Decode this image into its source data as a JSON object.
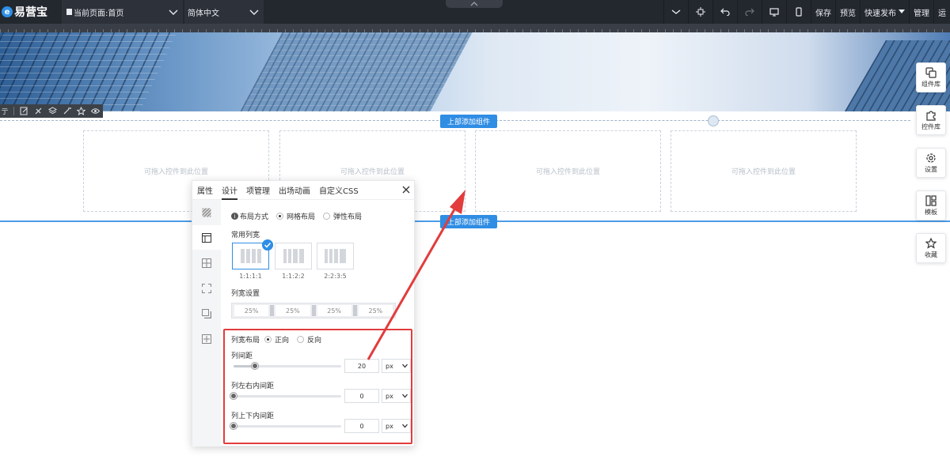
{
  "topbar": {
    "logo_mark": "e",
    "logo_text": "易营宝",
    "current_page": "当前页面:首页",
    "language": "简体中文",
    "save_label": "保存",
    "preview_label": "预览",
    "publish_label": "快速发布",
    "manage_label": "管理",
    "more_label": "运"
  },
  "canvas": {
    "add_top_label": "上部添加组件",
    "add_bottom_label": "上部添加组件",
    "drop_hint": "可拖入控件到此位置"
  },
  "side_menu": [
    {
      "label": "组件库",
      "icon": "layers-icon"
    },
    {
      "label": "控件库",
      "icon": "puzzle-icon"
    },
    {
      "label": "设置",
      "icon": "gear-icon"
    },
    {
      "label": "模板",
      "icon": "template-icon"
    },
    {
      "label": "收藏",
      "icon": "star-icon"
    }
  ],
  "row_toolbar": {
    "lead_label": "亍"
  },
  "panel": {
    "tabs": [
      "属性",
      "设计",
      "项管理",
      "出场动画",
      "自定义CSS"
    ],
    "active_tab": "设计",
    "layout_mode_label": "布局方式",
    "layout_options": [
      "网格布局",
      "弹性布局"
    ],
    "selected_layout": "网格布局",
    "common_widths_label": "常用列宽",
    "presets": [
      "1:1:1:1",
      "1:1:2:2",
      "2:2:3:5"
    ],
    "selected_preset": "1:1:1:1",
    "col_width_label": "列宽设置",
    "col_widths": [
      "25%",
      "25%",
      "25%",
      "25%"
    ],
    "col_layout_label": "列宽布局",
    "direction_options": [
      "正向",
      "反向"
    ],
    "selected_direction": "正向",
    "gap": {
      "label": "列间距",
      "value": "20",
      "unit": "px",
      "level": 0.2
    },
    "pad_lr": {
      "label": "列左右内间距",
      "value": "0",
      "unit": "px",
      "level": 0
    },
    "pad_tb": {
      "label": "列上下内间距",
      "value": "0",
      "unit": "px",
      "level": 0
    }
  },
  "colors": {
    "accent": "#2f8de4",
    "highlight": "#e23c3c",
    "topbar": "#23272e"
  }
}
